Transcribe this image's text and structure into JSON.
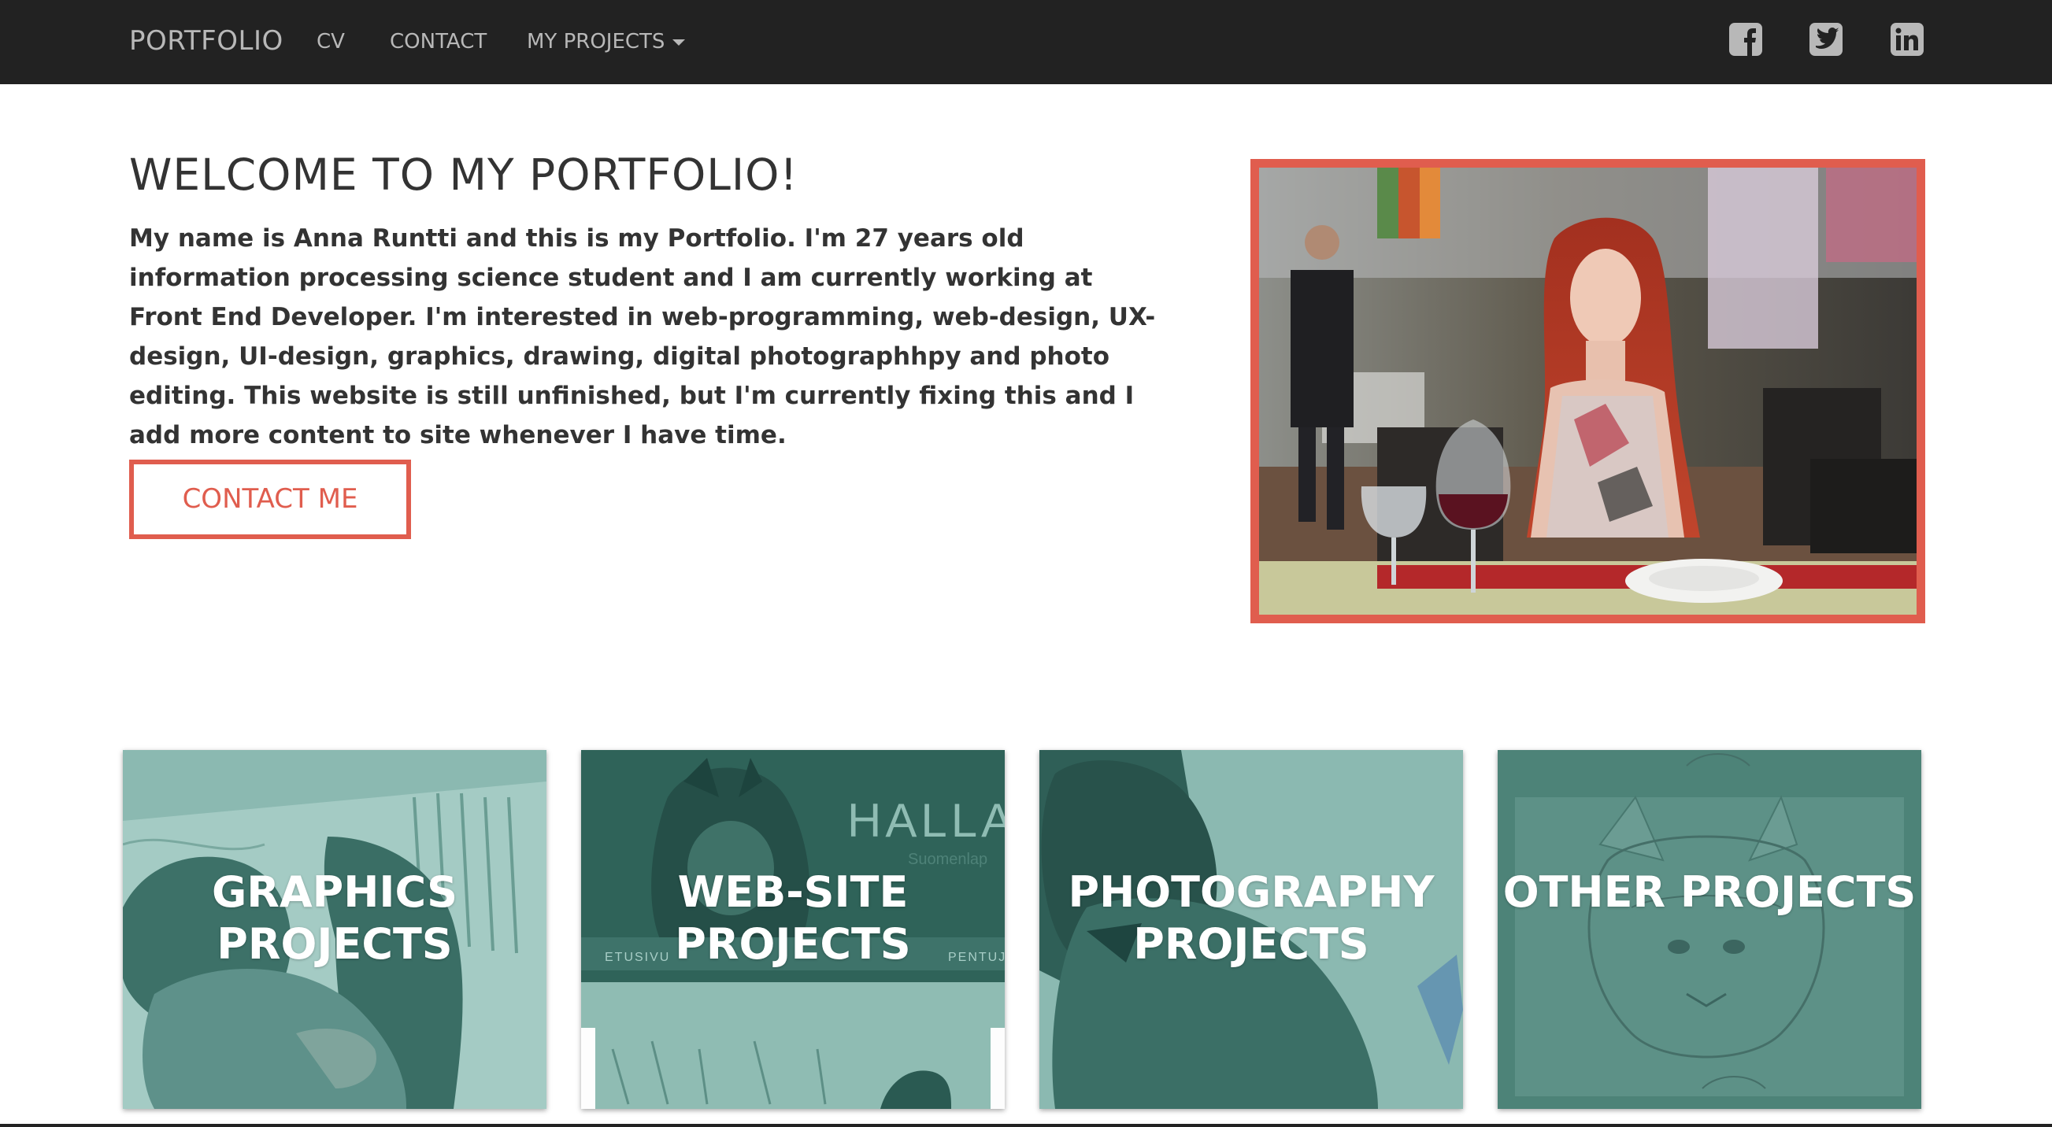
{
  "navbar": {
    "brand": "PORTFOLIO",
    "links": [
      {
        "label": "CV"
      },
      {
        "label": "CONTACT"
      },
      {
        "label": "MY PROJECTS"
      }
    ],
    "social_icons": [
      "facebook-icon",
      "twitter-icon",
      "linkedin-icon"
    ]
  },
  "hero": {
    "title": "WELCOME TO MY PORTFOLIO!",
    "text": "My name is Anna Runtti and this is my Portfolio. I'm 27 years old information processing science student and I am currently working at Front End Developer. I'm interested in web-programming, web-design, UX-design, UI-design, graphics, drawing, digital photographhpy and photo editing. This website is still unfinished, but I'm currently fixing this and I add more content to site whenever I have time.",
    "cta_label": "CONTACT ME"
  },
  "tiles": [
    {
      "label": "GRAPHICS PROJECTS"
    },
    {
      "label": "WEB-SITE PROJECTS",
      "image_text": "HALLA",
      "image_subtext": "Suomenlap",
      "image_nav": [
        "ETUSIVU",
        "PENTUJA"
      ]
    },
    {
      "label": "PHOTOGRAPHY PROJECTS"
    },
    {
      "label": "OTHER PROJECTS"
    }
  ],
  "colors": {
    "navbar_bg": "#222222",
    "nav_text": "#b8b8b8",
    "accent": "#e05d4e",
    "tile_overlay": "#4f8f86",
    "body_text": "#333333"
  }
}
